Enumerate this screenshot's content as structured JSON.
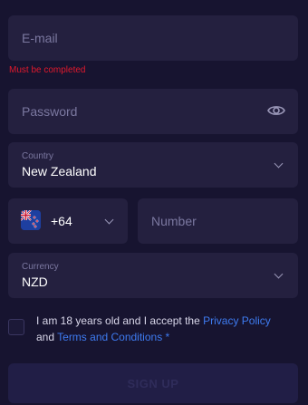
{
  "email": {
    "placeholder": "E-mail",
    "error": "Must be completed"
  },
  "password": {
    "placeholder": "Password"
  },
  "country": {
    "label": "Country",
    "value": "New Zealand"
  },
  "phone": {
    "code": "+64",
    "placeholder": "Number",
    "flag_icon": "new-zealand-flag-icon"
  },
  "currency": {
    "label": "Currency",
    "value": "NZD"
  },
  "terms": {
    "text_before": "I am 18 years old and I accept the ",
    "privacy_link": "Privacy Policy",
    "and": " and ",
    "terms_link": "Terms and Conditions",
    "required_mark": " *"
  },
  "submit": {
    "label": "SIGN UP"
  },
  "colors": {
    "background": "#171430",
    "field": "#24203f",
    "link": "#3e7bf0",
    "error": "#e0192d"
  }
}
